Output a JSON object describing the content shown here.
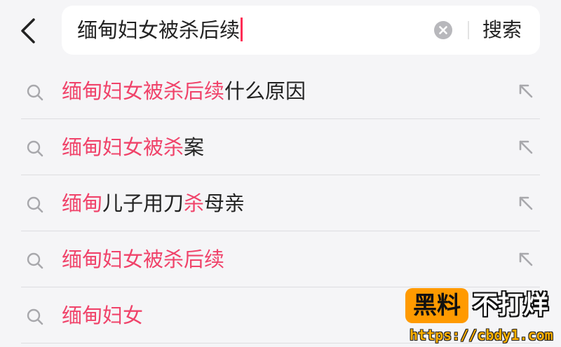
{
  "search": {
    "query": "缅甸妇女被杀后续",
    "submit_label": "搜索"
  },
  "suggestions": [
    {
      "parts": [
        {
          "text": "缅甸妇女被杀后续",
          "hl": true
        },
        {
          "text": "什么原因",
          "hl": false
        }
      ]
    },
    {
      "parts": [
        {
          "text": "缅甸妇女被杀",
          "hl": true
        },
        {
          "text": "案",
          "hl": false
        }
      ]
    },
    {
      "parts": [
        {
          "text": "缅甸",
          "hl": true
        },
        {
          "text": "儿子用刀",
          "hl": false
        },
        {
          "text": "杀",
          "hl": true
        },
        {
          "text": "母亲",
          "hl": false
        }
      ]
    },
    {
      "parts": [
        {
          "text": "缅甸妇女被杀后续",
          "hl": true
        }
      ]
    },
    {
      "parts": [
        {
          "text": "缅甸妇女",
          "hl": true
        }
      ]
    }
  ],
  "watermark": {
    "badge": "黑料",
    "title": "不打烊",
    "url": "https://cbdy1.com"
  },
  "colors": {
    "highlight": "#f0436a",
    "caret": "#fe2c55",
    "background": "#f5f5f7"
  },
  "icons": [
    "back-arrow-icon",
    "clear-icon",
    "search-icon",
    "fill-query-arrow-icon"
  ]
}
